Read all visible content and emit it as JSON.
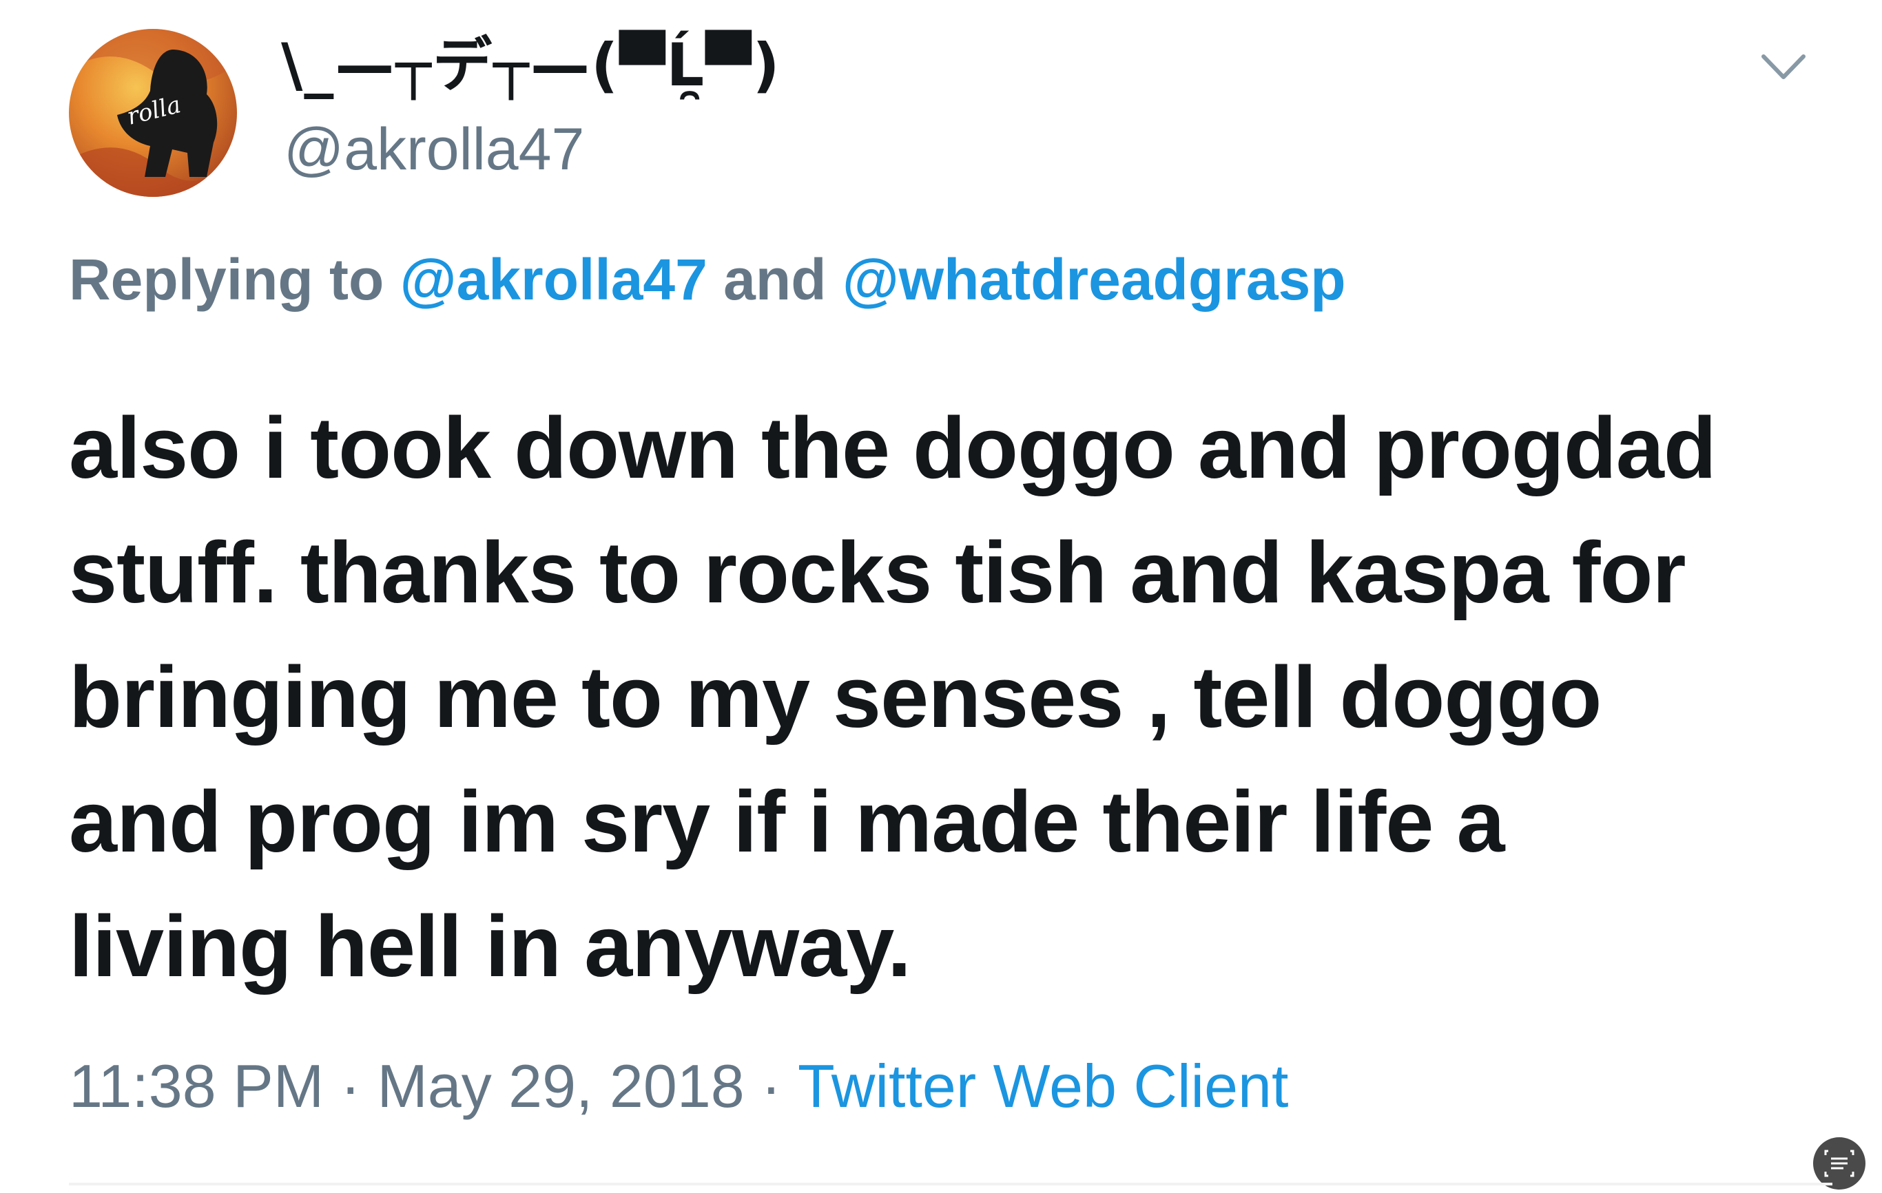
{
  "tweet": {
    "author": {
      "display_name": "\\_—┬デ┬—(▀̿Ĺ̯▀̿)",
      "handle": "@akrolla47",
      "avatar_text": "rolla"
    },
    "reply": {
      "prefix": "Replying to ",
      "mention_1": "@akrolla47",
      "joiner": " and ",
      "mention_2": "@whatdreadgrasp"
    },
    "text_lines": [
      "also i took down the doggo and progdad",
      "stuff. thanks to rocks tish and kaspa for",
      "bringing me to my senses , tell doggo",
      "and prog im sry if i made their life a",
      "living hell in anyway."
    ],
    "time": "11:38 PM",
    "date": "May 29, 2018",
    "separator": "·",
    "source": "Twitter Web Client"
  },
  "icons": {
    "menu": "chevron-down-icon",
    "badge": "scan-text-icon"
  },
  "colors": {
    "text": "#14171a",
    "muted": "#657786",
    "link": "#1b95e0"
  }
}
